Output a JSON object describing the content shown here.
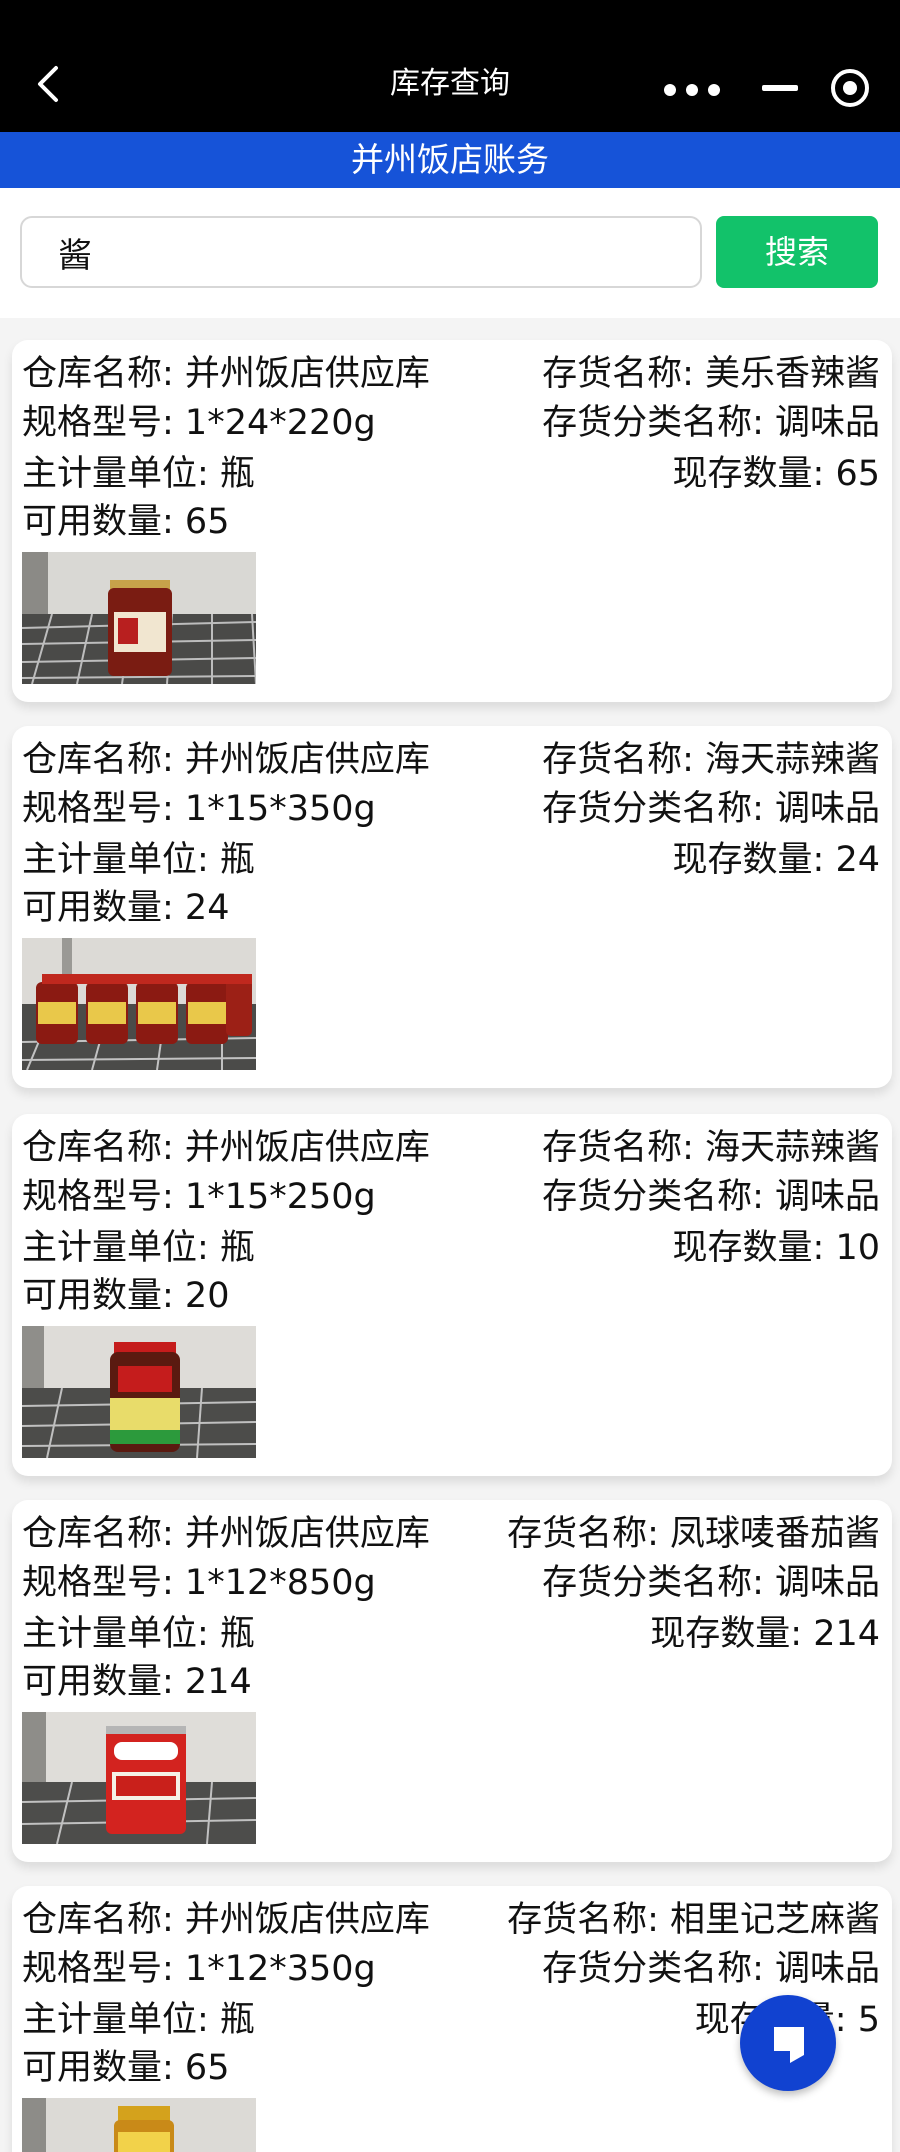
{
  "header": {
    "title": "库存查询"
  },
  "subtitle": "并州饭店账务",
  "search": {
    "value": "酱",
    "button_label": "搜索"
  },
  "labels": {
    "warehouse": "仓库名称: ",
    "item_name": "存货名称: ",
    "spec": "规格型号: ",
    "category": "存货分类名称: ",
    "unit": "主计量单位: ",
    "stock": "现存数量: ",
    "available": "可用数量: "
  },
  "items": [
    {
      "warehouse": "并州饭店供应库",
      "name": "美乐香辣酱",
      "spec": "1*24*220g",
      "category": "调味品",
      "unit": "瓶",
      "stock": "65",
      "available": "65"
    },
    {
      "warehouse": "并州饭店供应库",
      "name": "海天蒜辣酱",
      "spec": "1*15*350g",
      "category": "调味品",
      "unit": "瓶",
      "stock": "24",
      "available": "24"
    },
    {
      "warehouse": "并州饭店供应库",
      "name": "海天蒜辣酱",
      "spec": "1*15*250g",
      "category": "调味品",
      "unit": "瓶",
      "stock": "10",
      "available": "20"
    },
    {
      "warehouse": "并州饭店供应库",
      "name": "凤球唛番茄酱",
      "spec": "1*12*850g",
      "category": "调味品",
      "unit": "瓶",
      "stock": "214",
      "available": "214"
    },
    {
      "warehouse": "并州饭店供应库",
      "name": "相里记芝麻酱",
      "spec": "1*12*350g",
      "category": "调味品",
      "unit": "瓶",
      "stock": "5",
      "available": "65"
    }
  ],
  "icons": {
    "back": "chevron-left-icon",
    "more": "more-dots-icon",
    "minimize": "minimize-icon",
    "close": "target-close-icon",
    "fab": "float-action-icon"
  },
  "colors": {
    "accent_blue": "#1653d8",
    "search_green": "#12c26a",
    "fab_blue": "#1142d0"
  }
}
